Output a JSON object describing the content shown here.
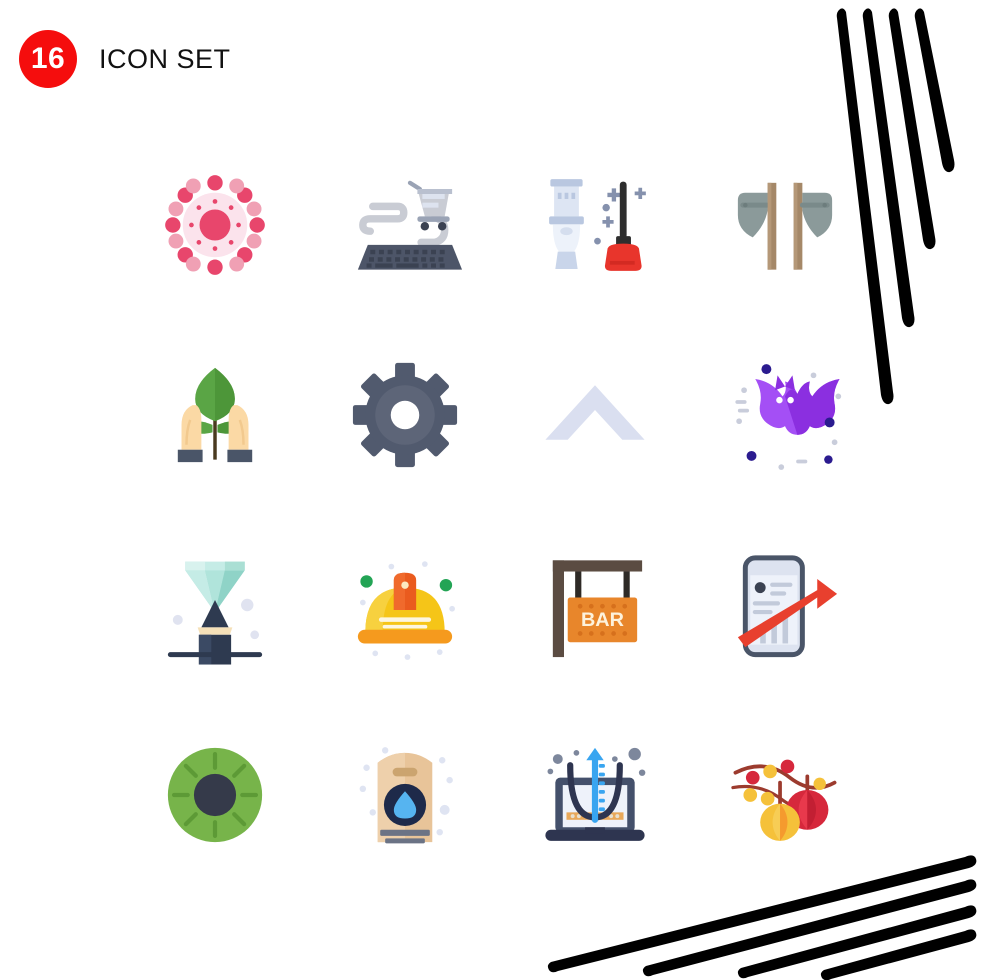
{
  "header": {
    "count": "16",
    "title": "Icon Set",
    "badge_color": "#f50d0d",
    "title_color": "#111111"
  },
  "canvas": {
    "background": "#ffffff",
    "width": "981",
    "height": "980"
  },
  "decorations": [
    {
      "name": "corner-strokes-top-right",
      "stroke_color": "#000000",
      "count": "4",
      "orientation": "steep-diagonal"
    },
    {
      "name": "corner-strokes-bottom-right",
      "stroke_color": "#000000",
      "count": "4",
      "orientation": "shallow-diagonal"
    }
  ],
  "grid": {
    "columns": "4",
    "rows": "4",
    "total": "16"
  },
  "icons": [
    {
      "id": "virus-dots-icon",
      "label": "Virus",
      "row": "1",
      "col": "1",
      "colors": [
        "#fbe3ec",
        "#e84c6d",
        "#ef8098"
      ]
    },
    {
      "id": "online-shopping-icon",
      "label": "Online Shopping",
      "row": "1",
      "col": "2",
      "colors": [
        "#4a5568",
        "#c9ccd4",
        "#b7c3d6"
      ]
    },
    {
      "id": "toilet-plunger-icon",
      "label": "Plumbing",
      "row": "1",
      "col": "3",
      "colors": [
        "#c9d5ea",
        "#e8e8f2",
        "#e8342c",
        "#2d2d2d"
      ]
    },
    {
      "id": "double-axe-icon",
      "label": "Axe",
      "row": "1",
      "col": "4",
      "colors": [
        "#8b9a9a",
        "#a58868"
      ]
    },
    {
      "id": "hands-plant-icon",
      "label": "Eco Care",
      "row": "2",
      "col": "1",
      "colors": [
        "#fbd9a5",
        "#5aa545",
        "#4a5568"
      ]
    },
    {
      "id": "gear-settings-icon",
      "label": "Settings",
      "row": "2",
      "col": "2",
      "colors": [
        "#515a6e",
        "#5d6578"
      ]
    },
    {
      "id": "chevron-up-icon",
      "label": "Up Arrow",
      "row": "2",
      "col": "3",
      "colors": [
        "#dadff0"
      ]
    },
    {
      "id": "bat-icon",
      "label": "Bat",
      "row": "2",
      "col": "4",
      "colors": [
        "#8b2fe0",
        "#a44ff5",
        "#2b1b8f"
      ]
    },
    {
      "id": "diamond-pencil-icon",
      "label": "Creativity",
      "row": "3",
      "col": "1",
      "colors": [
        "#9ad9cf",
        "#c5ece6",
        "#2e3a50",
        "#f5e0b8"
      ]
    },
    {
      "id": "hard-hat-icon",
      "label": "Hard Hat",
      "row": "3",
      "col": "2",
      "colors": [
        "#f5c518",
        "#f59a1e",
        "#ea5b1e",
        "#23a455"
      ]
    },
    {
      "id": "bar-sign-icon",
      "label": "Bar Sign",
      "row": "3",
      "col": "3",
      "sign_text": "BAR",
      "colors": [
        "#e8862b",
        "#5b4c42"
      ]
    },
    {
      "id": "mobile-growth-icon",
      "label": "Mobile Growth",
      "row": "3",
      "col": "4",
      "colors": [
        "#4a5568",
        "#dde3f0",
        "#e8402e"
      ]
    },
    {
      "id": "kiwi-slice-icon",
      "label": "Kiwi",
      "row": "4",
      "col": "1",
      "colors": [
        "#77b44a",
        "#353a4a"
      ]
    },
    {
      "id": "water-bag-icon",
      "label": "Water Pack",
      "row": "4",
      "col": "2",
      "colors": [
        "#e8c499",
        "#1e2a4a",
        "#56b4f0"
      ]
    },
    {
      "id": "laptop-parabola-icon",
      "label": "Math Chart",
      "row": "4",
      "col": "3",
      "colors": [
        "#44506b",
        "#2e3550",
        "#39a5f0"
      ]
    },
    {
      "id": "party-lanterns-icon",
      "label": "Lanterns",
      "row": "4",
      "col": "4",
      "colors": [
        "#d6283c",
        "#f5c13a",
        "#f59a2e",
        "#9c3b2e"
      ]
    }
  ]
}
